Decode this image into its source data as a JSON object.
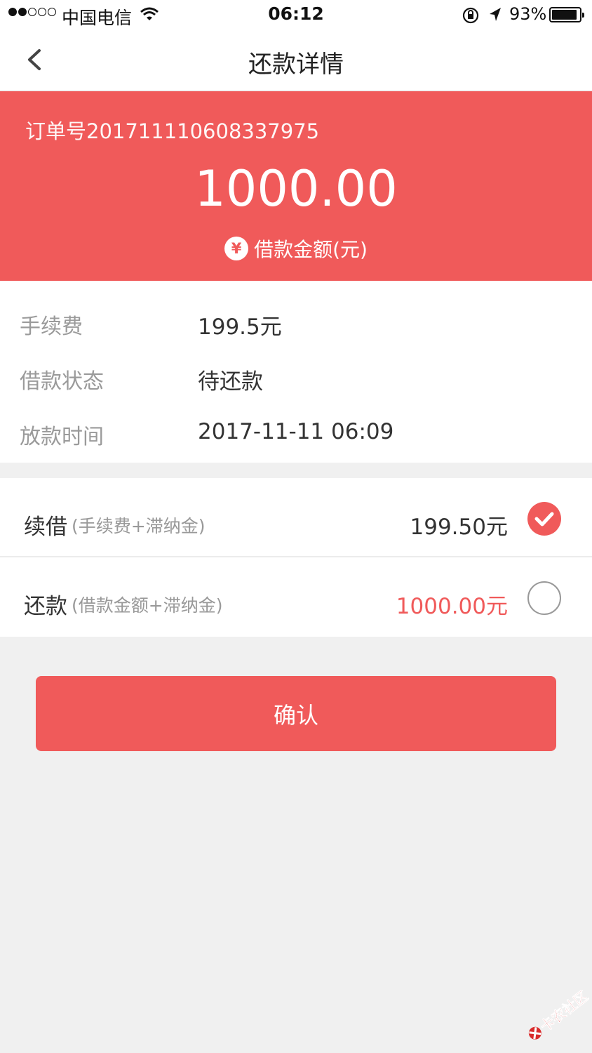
{
  "status_bar": {
    "carrier": "中国电信",
    "time": "06:12",
    "battery": "93%",
    "battery_level": 0.93
  },
  "nav": {
    "title": "还款详情"
  },
  "hero": {
    "order_number": "订单号201711110608337975",
    "amount": "1000.00",
    "currency_symbol": "¥",
    "amount_label": "借款金额(元)"
  },
  "info": [
    {
      "key": "手续费",
      "value": "199.5元"
    },
    {
      "key": "借款状态",
      "value": "待还款"
    },
    {
      "key": "放款时间",
      "value": "2017-11-11 06:09"
    }
  ],
  "options": [
    {
      "title": "续借",
      "subtitle": "(手续费+滞纳金)",
      "amount": "199.50元",
      "selected": true
    },
    {
      "title": "还款",
      "subtitle": "(借款金额+滞纳金)",
      "amount": "1000.00元",
      "selected": false
    }
  ],
  "confirm_label": "确认",
  "watermark": "卡农社区",
  "colors": {
    "accent": "#f05a5a",
    "background": "#f0f0f0"
  }
}
